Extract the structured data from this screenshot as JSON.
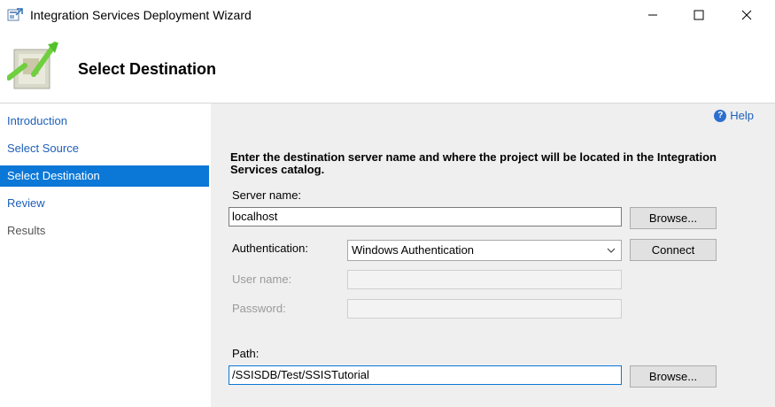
{
  "window": {
    "title": "Integration Services Deployment Wizard"
  },
  "header": {
    "title": "Select Destination"
  },
  "nav": {
    "items": [
      {
        "label": "Introduction"
      },
      {
        "label": "Select Source"
      },
      {
        "label": "Select Destination"
      },
      {
        "label": "Review"
      },
      {
        "label": "Results"
      }
    ]
  },
  "content": {
    "help_label": "Help",
    "instruction": "Enter the destination server name and where the project will be located in the Integration Services catalog.",
    "server": {
      "label": "Server name:",
      "value": "localhost",
      "browse_label": "Browse..."
    },
    "auth": {
      "label": "Authentication:",
      "value": "Windows Authentication",
      "connect_label": "Connect"
    },
    "username": {
      "label": "User name:",
      "value": ""
    },
    "password": {
      "label": "Password:",
      "value": ""
    },
    "path": {
      "label": "Path:",
      "value": "/SSISDB/Test/SSISTutorial",
      "browse_label": "Browse..."
    }
  }
}
